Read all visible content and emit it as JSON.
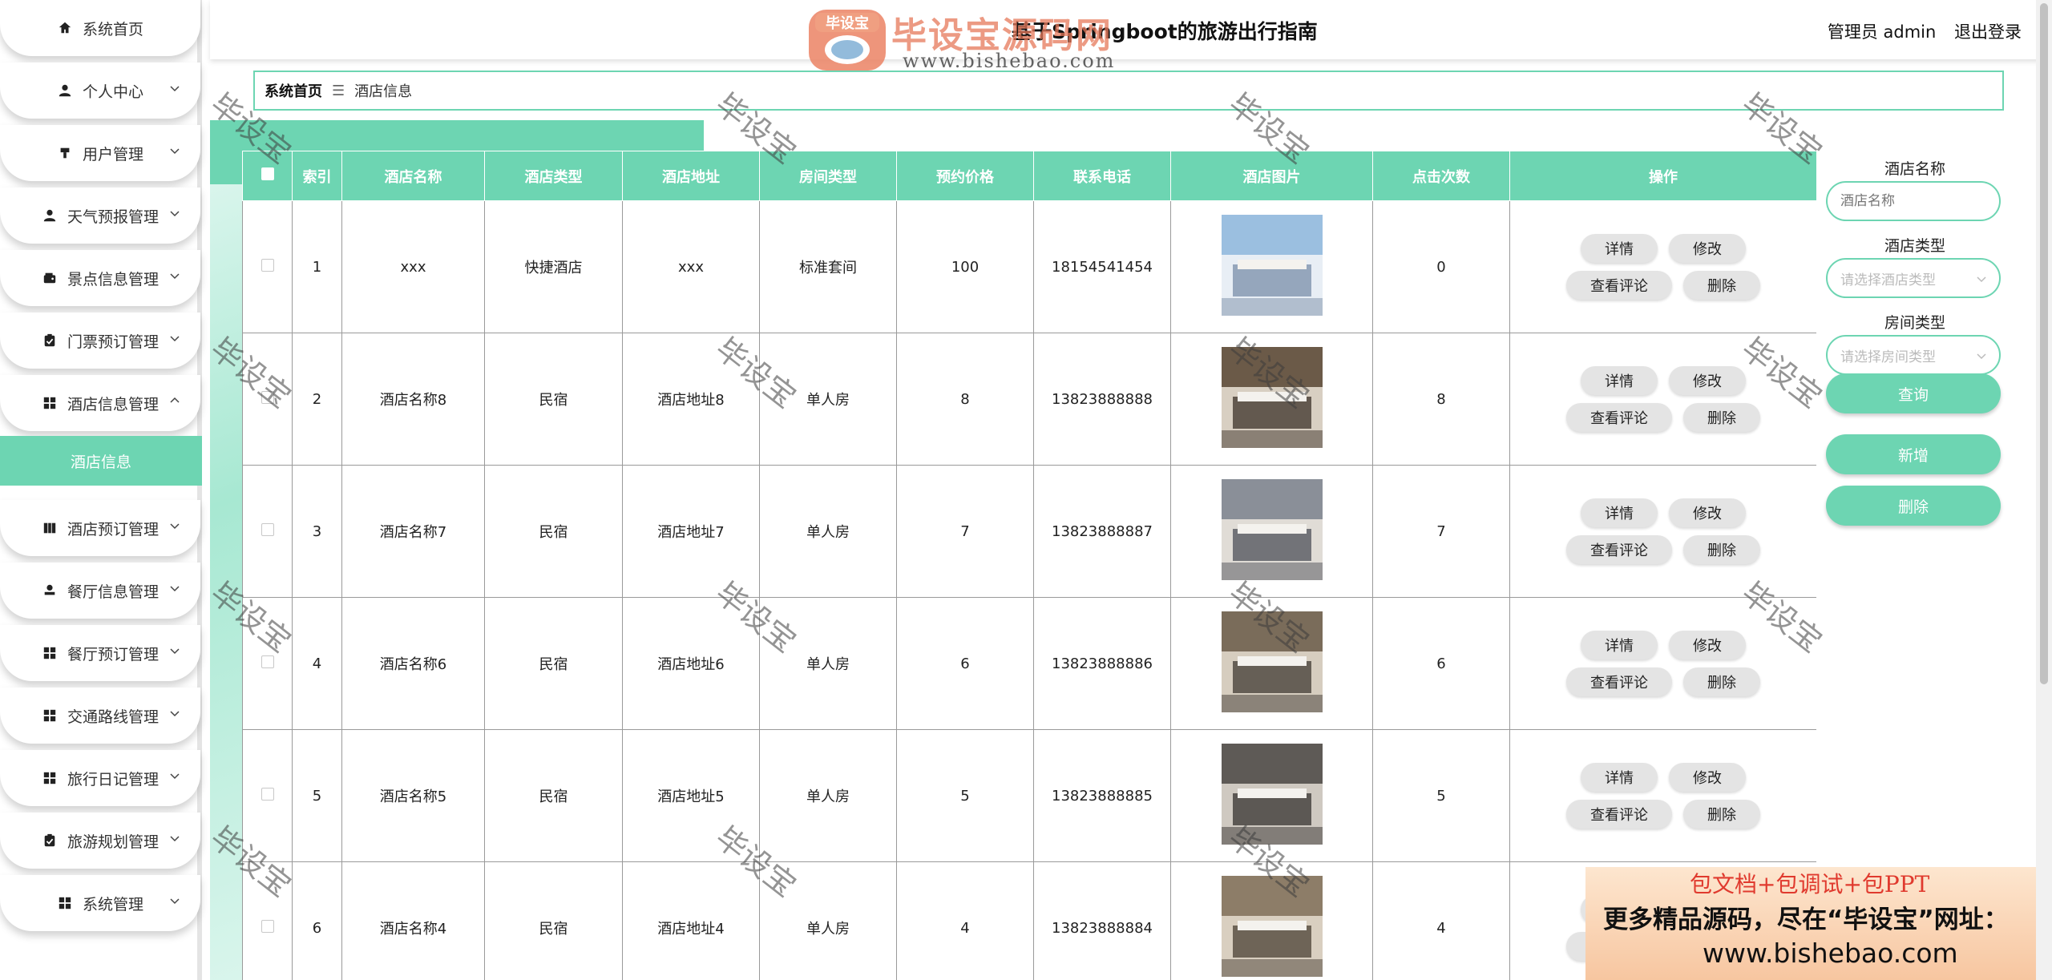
{
  "header": {
    "title": "基于Springboot的旅游出行指南",
    "user_label": "管理员 admin",
    "logout": "退出登录",
    "logo_text": "毕设宝源码网",
    "logo_badge": "毕设宝",
    "logo_url": "www.bishebao.com"
  },
  "sidebar": {
    "items": [
      {
        "label": "系统首页",
        "icon": "home-icon"
      },
      {
        "label": "个人中心",
        "icon": "user-icon"
      },
      {
        "label": "用户管理",
        "icon": "users-icon"
      },
      {
        "label": "天气预报管理",
        "icon": "user-icon"
      },
      {
        "label": "景点信息管理",
        "icon": "wallet-icon"
      },
      {
        "label": "门票预订管理",
        "icon": "clipboard-icon"
      },
      {
        "label": "酒店信息管理",
        "icon": "grid-icon"
      },
      {
        "label": "酒店预订管理",
        "icon": "book-icon"
      },
      {
        "label": "餐厅信息管理",
        "icon": "stamp-icon"
      },
      {
        "label": "餐厅预订管理",
        "icon": "grid-icon"
      },
      {
        "label": "交通路线管理",
        "icon": "grid-icon"
      },
      {
        "label": "旅行日记管理",
        "icon": "grid-icon"
      },
      {
        "label": "旅游规划管理",
        "icon": "clipboard-icon"
      },
      {
        "label": "系统管理",
        "icon": "grid-icon"
      }
    ],
    "active_sub": "酒店信息"
  },
  "breadcrumb": {
    "home": "系统首页",
    "sep": "☰",
    "current": "酒店信息"
  },
  "table": {
    "columns": [
      "索引",
      "酒店名称",
      "酒店类型",
      "酒店地址",
      "房间类型",
      "预约价格",
      "联系电话",
      "酒店图片",
      "点击次数",
      "操作"
    ],
    "rows": [
      {
        "index": "1",
        "name": "xxx",
        "type": "快捷酒店",
        "address": "xxx",
        "room": "标准套间",
        "price": "100",
        "phone": "18154541454",
        "clicks": "0"
      },
      {
        "index": "2",
        "name": "酒店名称8",
        "type": "民宿",
        "address": "酒店地址8",
        "room": "单人房",
        "price": "8",
        "phone": "13823888888",
        "clicks": "8"
      },
      {
        "index": "3",
        "name": "酒店名称7",
        "type": "民宿",
        "address": "酒店地址7",
        "room": "单人房",
        "price": "7",
        "phone": "13823888887",
        "clicks": "7"
      },
      {
        "index": "4",
        "name": "酒店名称6",
        "type": "民宿",
        "address": "酒店地址6",
        "room": "单人房",
        "price": "6",
        "phone": "13823888886",
        "clicks": "6"
      },
      {
        "index": "5",
        "name": "酒店名称5",
        "type": "民宿",
        "address": "酒店地址5",
        "room": "单人房",
        "price": "5",
        "phone": "13823888885",
        "clicks": "5"
      },
      {
        "index": "6",
        "name": "酒店名称4",
        "type": "民宿",
        "address": "酒店地址4",
        "room": "单人房",
        "price": "4",
        "phone": "13823888884",
        "clicks": "4"
      }
    ],
    "ops": {
      "detail": "详情",
      "edit": "修改",
      "reviews": "查看评论",
      "delete": "删除"
    }
  },
  "search": {
    "name_label": "酒店名称",
    "name_placeholder": "酒店名称",
    "type_label": "酒店类型",
    "type_placeholder": "请选择酒店类型",
    "room_label": "房间类型",
    "room_placeholder": "请选择房间类型",
    "query": "查询",
    "add": "新增",
    "delete": "删除"
  },
  "watermark": "毕设宝",
  "ad": {
    "line1": "包文档+包调试+包PPT",
    "line2": "更多精品源码，尽在“毕设宝”网址：",
    "line3": "www.bishebao.com"
  },
  "colors": {
    "accent": "#6dd5b2",
    "button_gray": "#e4e4e4"
  }
}
